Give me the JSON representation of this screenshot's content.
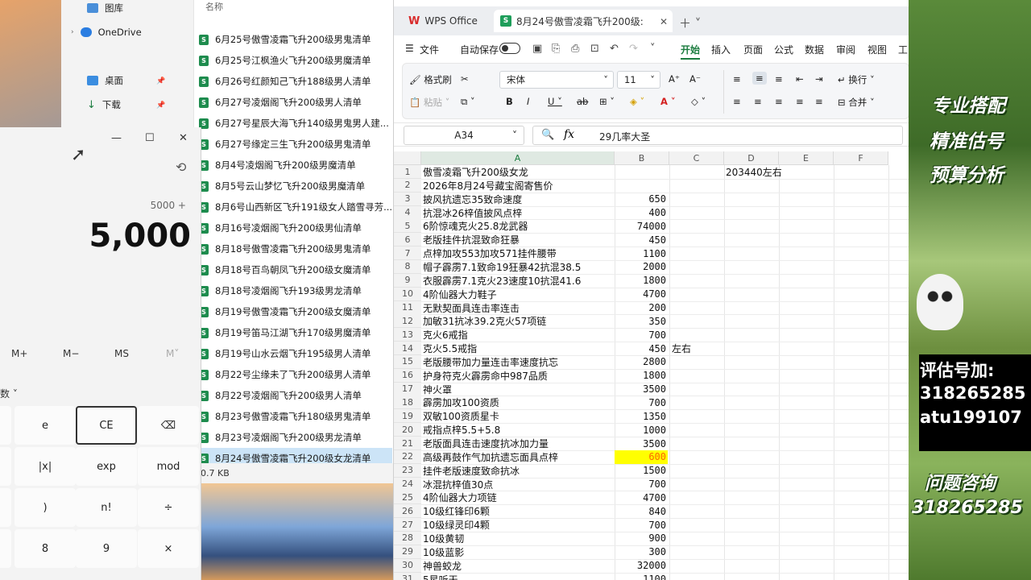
{
  "explorer": {
    "nav": [
      {
        "label": "图库",
        "pinned": false
      },
      {
        "label": "OneDrive",
        "pinned": false
      },
      {
        "label": "桌面",
        "pinned": true
      },
      {
        "label": "下载",
        "pinned": true
      }
    ],
    "column_header": "名称",
    "files": [
      "6月25号傲雪凌霜飞升200级男鬼清单",
      "6月25号江枫渔火飞升200级男魔清单",
      "6月26号红颜知己飞升188级男人清单",
      "6月27号凌烟阁飞升200级男人清单",
      "6月27号星辰大海飞升140级男鬼男人建...",
      "6月27号缘定三生飞升200级男鬼清单",
      "8月4号凌烟阁飞升200级男魔清单",
      "8月5号云山梦忆飞升200级男魔清单",
      "8月6号山西新区飞升191级女人踏雪寻芳...",
      "8月16号凌烟阁飞升200级男仙清单",
      "8月18号傲雪凌霜飞升200级男鬼清单",
      "8月18号百鸟朝凤飞升200级女魔清单",
      "8月18号凌烟阁飞升193级男龙清单",
      "8月19号傲雪凌霜飞升200级女魔清单",
      "8月19号笛马江湖飞升170级男魔清单",
      "8月19号山水云烟飞升195级男人清单",
      "8月22号尘缘未了飞升200级男人清单",
      "8月22号凌烟阁飞升200级男人清单",
      "8月23号傲雪凌霜飞升180级男鬼清单",
      "8月23号凌烟阁飞升200级男龙清单",
      "8月24号傲雪凌霜飞升200级女龙清单"
    ],
    "selected_index": 20,
    "status_size": "0.7 KB"
  },
  "calculator": {
    "expression": "5000 +",
    "display": "5,000",
    "memory": [
      "M+",
      "M−",
      "MS",
      "M˅"
    ],
    "mode_label": "数 ˅",
    "keys": [
      {
        "label": "e",
        "highlight": false
      },
      {
        "label": "CE",
        "highlight": true
      },
      {
        "label": "⌫",
        "highlight": false
      },
      {
        "label": "|x|",
        "highlight": false
      },
      {
        "label": "exp",
        "highlight": false
      },
      {
        "label": "mod",
        "highlight": false
      },
      {
        "label": ")",
        "highlight": false
      },
      {
        "label": "n!",
        "highlight": false
      },
      {
        "label": "÷",
        "highlight": false
      },
      {
        "label": "8",
        "highlight": false
      },
      {
        "label": "9",
        "highlight": false
      },
      {
        "label": "×",
        "highlight": false
      }
    ]
  },
  "wps": {
    "app_tab": "WPS Office",
    "doc_tab": "8月24号傲雪凌霜飞升200级:",
    "menu": {
      "file": "文件",
      "autosave": "自动保存",
      "items": [
        "开始",
        "插入",
        "页面",
        "公式",
        "数据",
        "审阅",
        "视图",
        "工"
      ],
      "active": "开始"
    },
    "ribbon": {
      "format_painter": "格式刷",
      "paste": "粘贴",
      "font_name": "宋体",
      "font_size": "11",
      "wrap": "换行",
      "merge": "合并"
    },
    "name_box": "A34",
    "formula": "29几率大圣",
    "columns": [
      "A",
      "B",
      "C",
      "D",
      "E",
      "F"
    ],
    "selected_column": "A",
    "rows": [
      {
        "n": "1",
        "a": "傲雪凌霜飞升200级女龙",
        "b": "",
        "c": "",
        "d": "203440左右"
      },
      {
        "n": "2",
        "a": "2026年8月24号藏宝阁寄售价",
        "b": "",
        "c": "",
        "d": ""
      },
      {
        "n": "3",
        "a": "披风抗遗忘35致命速度",
        "b": "650",
        "c": "",
        "d": ""
      },
      {
        "n": "4",
        "a": "抗混冰26梓值披风点梓",
        "b": "400",
        "c": "",
        "d": ""
      },
      {
        "n": "5",
        "a": "6阶惊魂克火25.8龙武器",
        "b": "74000",
        "c": "",
        "d": ""
      },
      {
        "n": "6",
        "a": "老版挂件抗混致命狂暴",
        "b": "450",
        "c": "",
        "d": ""
      },
      {
        "n": "7",
        "a": "点梓加攻553加攻571挂件腰带",
        "b": "1100",
        "c": "",
        "d": ""
      },
      {
        "n": "8",
        "a": "帽子霹雳7.1致命19狂暴42抗混38.5",
        "b": "2000",
        "c": "",
        "d": ""
      },
      {
        "n": "9",
        "a": "衣服霹雳7.1克火23速度10抗混41.6",
        "b": "1800",
        "c": "",
        "d": ""
      },
      {
        "n": "10",
        "a": "4阶仙器大力鞋子",
        "b": "4700",
        "c": "",
        "d": ""
      },
      {
        "n": "11",
        "a": "无默契面具连击率连击",
        "b": "200",
        "c": "",
        "d": ""
      },
      {
        "n": "12",
        "a": "加敏31抗冰39.2克火57项链",
        "b": "350",
        "c": "",
        "d": ""
      },
      {
        "n": "13",
        "a": "克火6戒指",
        "b": "700",
        "c": "",
        "d": ""
      },
      {
        "n": "14",
        "a": "克火5.5戒指",
        "b": "450",
        "c": "左右",
        "d": ""
      },
      {
        "n": "15",
        "a": "老版腰带加力量连击率速度抗忘",
        "b": "2800",
        "c": "",
        "d": ""
      },
      {
        "n": "16",
        "a": "护身符克火霹雳命中987品质",
        "b": "1800",
        "c": "",
        "d": ""
      },
      {
        "n": "17",
        "a": "神火罩",
        "b": "3500",
        "c": "",
        "d": ""
      },
      {
        "n": "18",
        "a": "霹雳加攻100资质",
        "b": "700",
        "c": "",
        "d": ""
      },
      {
        "n": "19",
        "a": "双敏100资质星卡",
        "b": "1350",
        "c": "",
        "d": ""
      },
      {
        "n": "20",
        "a": "戒指点梓5.5+5.8",
        "b": "1000",
        "c": "",
        "d": ""
      },
      {
        "n": "21",
        "a": "老版面具连击速度抗冰加力量",
        "b": "3500",
        "c": "",
        "d": ""
      },
      {
        "n": "22",
        "a": "高级再鼓作气加抗遗忘面具点梓",
        "b": "600",
        "c": "",
        "d": "",
        "highlight": true
      },
      {
        "n": "23",
        "a": "挂件老版速度致命抗冰",
        "b": "1500",
        "c": "",
        "d": ""
      },
      {
        "n": "24",
        "a": "冰混抗梓值30点",
        "b": "700",
        "c": "",
        "d": ""
      },
      {
        "n": "25",
        "a": "4阶仙器大力项链",
        "b": "4700",
        "c": "",
        "d": ""
      },
      {
        "n": "26",
        "a": "10级红锋印6颗",
        "b": "840",
        "c": "",
        "d": ""
      },
      {
        "n": "27",
        "a": "10级绿灵印4颗",
        "b": "700",
        "c": "",
        "d": ""
      },
      {
        "n": "28",
        "a": "10级黄韧",
        "b": "900",
        "c": "",
        "d": ""
      },
      {
        "n": "29",
        "a": "10级蓝影",
        "b": "300",
        "c": "",
        "d": ""
      },
      {
        "n": "30",
        "a": "神兽蛟龙",
        "b": "32000",
        "c": "",
        "d": ""
      },
      {
        "n": "31",
        "a": "5星听天",
        "b": "1100",
        "c": "",
        "d": ""
      }
    ],
    "highlight_color": "#ffff00",
    "highlight_text_color": "#ff6600"
  },
  "promo": {
    "line1": "专业搭配",
    "line2": "精准估号",
    "line3": "预算分析",
    "contact_title": "评估号加:",
    "contact_qq": "318265285",
    "contact_id": "atu199107",
    "consult_title": "问题咨询",
    "consult_qq": "318265285"
  }
}
